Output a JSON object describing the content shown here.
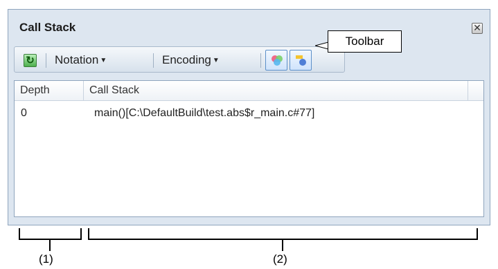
{
  "panel": {
    "title": "Call Stack",
    "close_icon": "close-icon"
  },
  "toolbar": {
    "refresh_icon": "refresh-icon",
    "notation_label": "Notation",
    "encoding_label": "Encoding",
    "icon_button_1": "color-palette-icon",
    "icon_button_2": "paint-tool-icon"
  },
  "callout": {
    "label": "Toolbar"
  },
  "table": {
    "columns": [
      "Depth",
      "Call Stack"
    ],
    "rows": [
      {
        "depth": "0",
        "call_stack": "main()[C:\\DefaultBuild\\test.abs$r_main.c#77]"
      }
    ]
  },
  "annotations": {
    "label_1": "(1)",
    "label_2": "(2)"
  }
}
